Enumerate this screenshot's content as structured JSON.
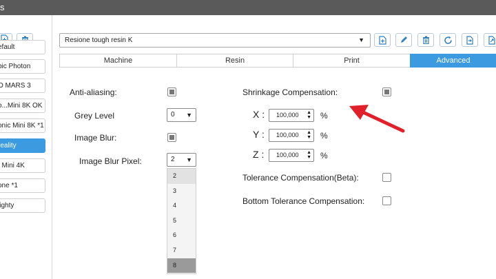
{
  "window": {
    "title": "s"
  },
  "left_panel": {
    "items": [
      {
        "label": "efault",
        "selected": false
      },
      {
        "label": "bic Photon",
        "selected": false
      },
      {
        "label": "O MARS 3",
        "selected": false
      },
      {
        "label": "o...Mini 8K OK",
        "selected": false
      },
      {
        "label": "onic Mini 8K *1",
        "selected": false
      },
      {
        "label": "reality",
        "selected": true
      },
      {
        "label": ": Mini 4K",
        "selected": false
      },
      {
        "label": "one *1",
        "selected": false
      },
      {
        "label": "lighty",
        "selected": false
      }
    ],
    "toolbar_icons": [
      "add-icon",
      "delete-icon"
    ]
  },
  "resin": {
    "selected": "Resione tough resin K",
    "toolbar_icons": [
      "add-icon",
      "edit-icon",
      "delete-icon",
      "refresh-icon",
      "import-icon",
      "export-icon"
    ]
  },
  "tabs": [
    {
      "label": "Machine",
      "active": false
    },
    {
      "label": "Resin",
      "active": false
    },
    {
      "label": "Print",
      "active": false
    },
    {
      "label": "Advanced",
      "active": true
    }
  ],
  "advanced": {
    "anti_aliasing": {
      "label": "Anti-aliasing:",
      "checked": true
    },
    "grey_level": {
      "label": "Grey Level",
      "value": "0"
    },
    "image_blur": {
      "label": "Image Blur:",
      "checked": true
    },
    "image_blur_pixel": {
      "label": "Image Blur Pixel:",
      "value": "2",
      "options": [
        "2",
        "3",
        "4",
        "5",
        "6",
        "7",
        "8"
      ],
      "highlighted": "8"
    },
    "shrinkage": {
      "label": "Shrinkage Compensation:",
      "checked": true,
      "x": {
        "label": "X :",
        "value": "100,000",
        "unit": "%"
      },
      "y": {
        "label": "Y :",
        "value": "100,000",
        "unit": "%"
      },
      "z": {
        "label": "Z :",
        "value": "100,000",
        "unit": "%"
      }
    },
    "tolerance": {
      "label": "Tolerance Compensation(Beta):",
      "checked": false
    },
    "bottom_tolerance": {
      "label": "Bottom Tolerance Compensation:",
      "checked": false
    }
  },
  "colors": {
    "accent": "#3c9be0",
    "annotation_arrow": "#e0202a",
    "titlebar": "#5a5a5a"
  }
}
